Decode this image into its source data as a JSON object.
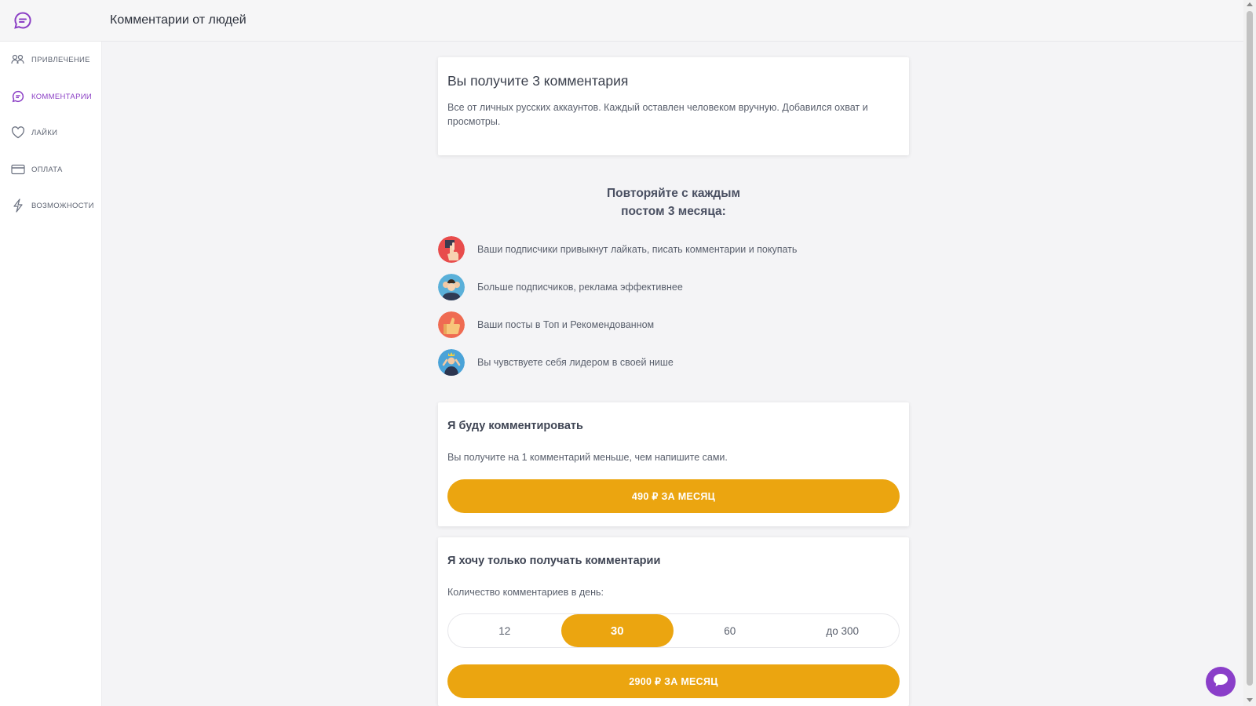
{
  "header": {
    "title": "Комментарии от людей",
    "logo_icon": "chat-bubble-icon",
    "brand_color": "#8b3fc5"
  },
  "sidebar": {
    "items": [
      {
        "label": "ПРИВЛЕЧЕНИЕ",
        "icon": "people-icon",
        "active": false
      },
      {
        "label": "КОММЕНТАРИИ",
        "icon": "chat-bubble-icon",
        "active": true
      },
      {
        "label": "ЛАЙКИ",
        "icon": "heart-icon",
        "active": false
      },
      {
        "label": "ОПЛАТА",
        "icon": "credit-card-icon",
        "active": false
      },
      {
        "label": "ВОЗМОЖНОСТИ",
        "icon": "lightning-icon",
        "active": false
      }
    ]
  },
  "summary": {
    "title": "Вы получите 3 комментария",
    "text": "Все от личных русских аккаунтов. Каждый оставлен человеком вручную. Добавился охват и просмотры."
  },
  "repeat": {
    "line1": "Повторяйте с каждым",
    "line2": "постом 3 месяца:"
  },
  "benefits": [
    {
      "text": "Ваши подписчики привыкнут лайкать, писать комментарии и покупать",
      "icon": "pointing-hand-icon"
    },
    {
      "text": "Больше подписчиков, реклама эффективнее",
      "icon": "crowd-icon"
    },
    {
      "text": "Ваши посты в Топ и Рекомендованном",
      "icon": "thumbs-up-icon"
    },
    {
      "text": "Вы чувствуете себя лидером в своей нише",
      "icon": "leader-icon"
    }
  ],
  "plan_comment": {
    "title": "Я буду комментировать",
    "description": "Вы получите на 1 комментарий меньше, чем напишите сами.",
    "button": "490 ₽ ЗА МЕСЯЦ"
  },
  "plan_receive": {
    "title": "Я хочу только получать комментарии",
    "label": "Количество комментариев в день:",
    "options": [
      "12",
      "30",
      "60",
      "до 300"
    ],
    "selected": "30",
    "button": "2900 ₽ ЗА МЕСЯЦ"
  },
  "colors": {
    "accent": "#eba510",
    "brand": "#8b3fc5"
  },
  "chat_widget": {
    "icon": "chat-bubble-icon"
  }
}
